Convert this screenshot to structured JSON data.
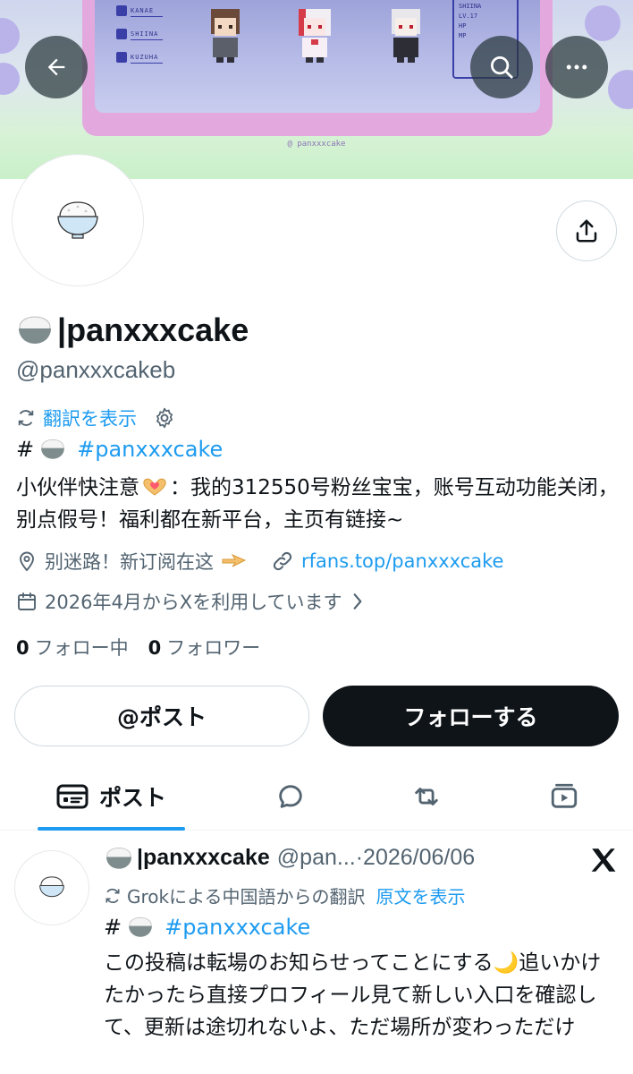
{
  "banner": {
    "menu": [
      "KANAE",
      "SHIINA",
      "KUZUHA"
    ],
    "stats_name": "SHIINA",
    "stats_level": "LV.17",
    "stats_hp": "HP",
    "stats_mp": "MP",
    "watermark": "@ panxxxcake"
  },
  "nav": {
    "back_icon": "arrow-left-icon",
    "search_icon": "search-icon",
    "more_icon": "more-horizontal-icon"
  },
  "profile": {
    "name": "|panxxxcake",
    "handle": "@panxxxcakeb",
    "translate_label": "翻訳を表示",
    "hashtag": "#panxxxcake",
    "bio_part1": "小伙伴快注意",
    "bio_part2": "：我的312550号粉丝宝宝，账号互动功能关闭，别点假号！福利都在新平台，主页有链接~",
    "location": "别迷路！新订阅在这",
    "website": "rfans.top/panxxxcake",
    "joined": "2026年4月からXを利用しています",
    "following_count": "0",
    "following_label": "フォロー中",
    "followers_count": "0",
    "followers_label": "フォロワー"
  },
  "actions": {
    "mention_label": "@ポスト",
    "follow_label": "フォローする"
  },
  "tabs": [
    {
      "label": "ポスト",
      "icon": "posts-icon",
      "active": true
    },
    {
      "label": "",
      "icon": "reply-icon",
      "active": false
    },
    {
      "label": "",
      "icon": "repost-icon",
      "active": false
    },
    {
      "label": "",
      "icon": "media-icon",
      "active": false
    }
  ],
  "post": {
    "name": "|panxxxcake",
    "handle": "@pan...",
    "separator": "·",
    "date": "2026/06/06",
    "translate_note": "Grokによる中国語からの翻訳",
    "show_original": "原文を表示",
    "hashtag": "#panxxxcake",
    "body": "この投稿は転場のお知らせってことにする🌙追いかけたかったら直接プロフィール見て新しい入口を確認して、更新は途切れないよ、ただ場所が変わっただけ"
  },
  "colors": {
    "accent": "#1d9bf0",
    "text": "#0f1419",
    "muted": "#536471",
    "banner_frame": "#e3a9df"
  }
}
